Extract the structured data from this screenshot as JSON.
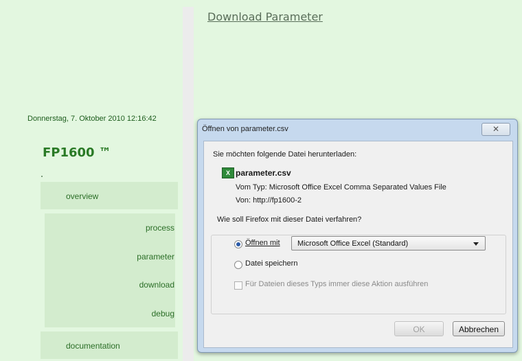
{
  "header": {
    "download_link": "Download Parameter"
  },
  "sidebar": {
    "timestamp": "Donnerstag, 7. Oktober 2010 12:16:42",
    "product": "FP1600 ™",
    "items": [
      {
        "label": "overview"
      },
      {
        "label": "process"
      },
      {
        "label": "parameter"
      },
      {
        "label": "download"
      },
      {
        "label": "debug"
      },
      {
        "label": "documentation"
      }
    ]
  },
  "dialog": {
    "title": "Öffnen von parameter.csv",
    "close_label": "✕",
    "prompt": "Sie möchten folgende Datei herunterladen:",
    "filename": "parameter.csv",
    "type_line": "Vom Typ:  Microsoft Office Excel Comma Separated Values File",
    "from_line": "Von:  http://fp1600-2",
    "question": "Wie soll Firefox mit dieser Datei verfahren?",
    "open_with_label": "Öffnen mit",
    "open_with_value": "Microsoft Office Excel (Standard)",
    "save_label": "Datei speichern",
    "always_label": "Für Dateien dieses Typs immer diese Aktion ausführen",
    "ok_label": "OK",
    "cancel_label": "Abbrechen"
  },
  "colors": {
    "background": "#e3f7e0",
    "accent": "#2a7a26"
  }
}
